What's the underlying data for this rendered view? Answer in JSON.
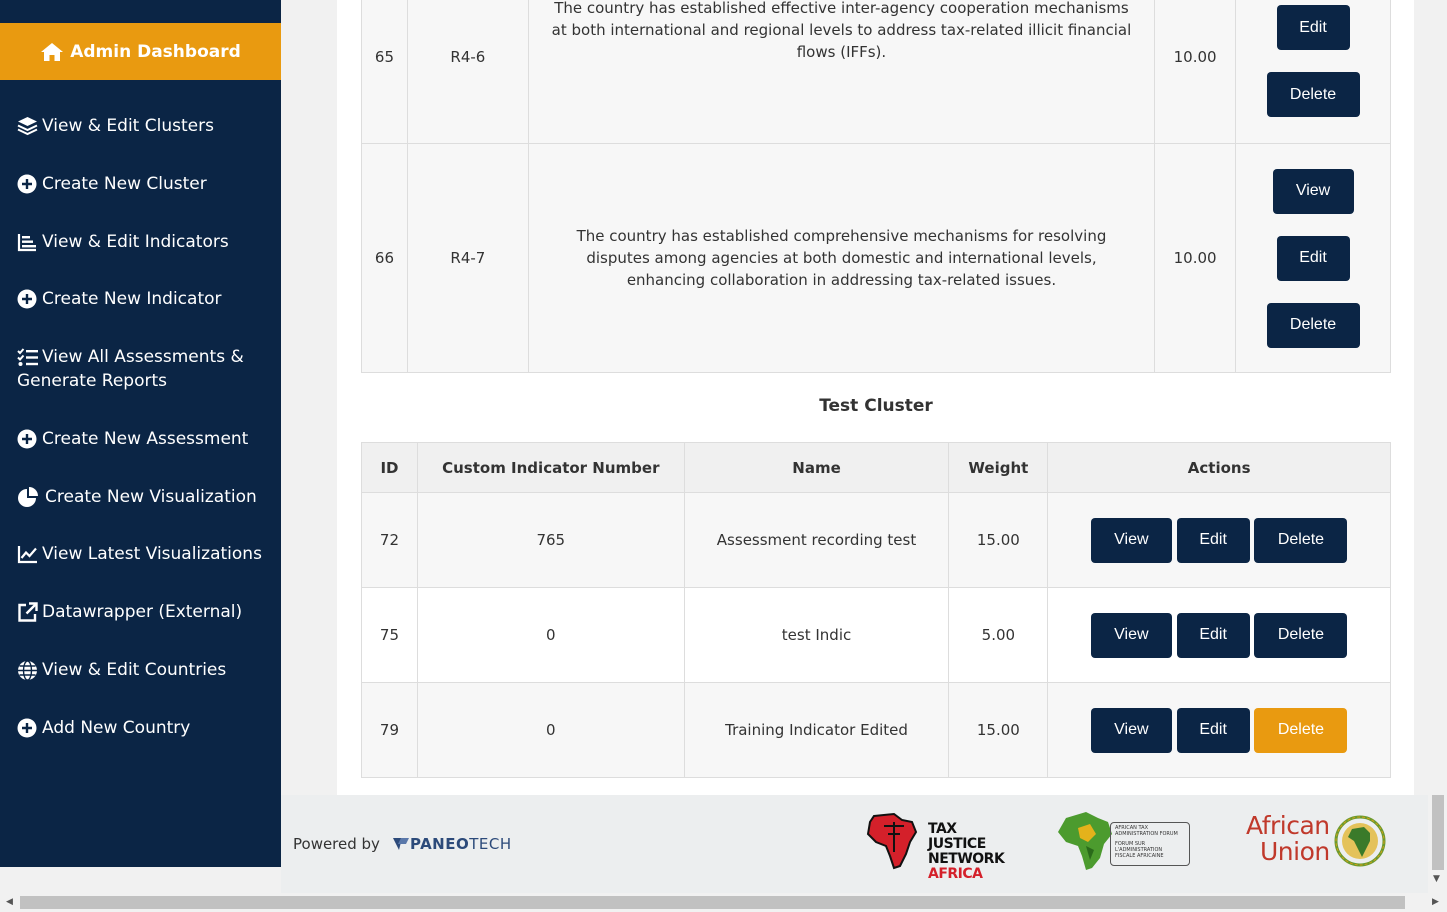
{
  "sidebar": {
    "header": "Admin Dashboard",
    "items": [
      {
        "label": "View & Edit Clusters",
        "icon": "layers-icon"
      },
      {
        "label": "Create New Cluster",
        "icon": "plus-circle-icon"
      },
      {
        "label": "View & Edit Indicators",
        "icon": "list-chart-icon"
      },
      {
        "label": "Create New Indicator",
        "icon": "plus-circle-icon"
      },
      {
        "label": "View All Assessments & Generate Reports",
        "icon": "checklist-icon"
      },
      {
        "label": "Create New Assessment",
        "icon": "plus-circle-icon"
      },
      {
        "label": "Create New Visualization",
        "icon": "pie-chart-icon"
      },
      {
        "label": "View Latest Visualizations",
        "icon": "line-chart-icon"
      },
      {
        "label": "Datawrapper (External)",
        "icon": "external-link-icon"
      },
      {
        "label": "View & Edit Countries",
        "icon": "globe-icon"
      },
      {
        "label": "Add New Country",
        "icon": "plus-circle-icon"
      }
    ]
  },
  "top_table": {
    "rows": [
      {
        "id": "65",
        "custom": "R4-6",
        "name": "The country has established effective inter-agency cooperation mechanisms at both international and regional levels to address tax-related illicit financial flows (IFFs).",
        "weight": "10.00"
      },
      {
        "id": "66",
        "custom": "R4-7",
        "name": "The country has established comprehensive mechanisms for resolving disputes among agencies at both domestic and international levels, enhancing collaboration in addressing tax-related issues.",
        "weight": "10.00"
      }
    ]
  },
  "cluster": {
    "title": "Test Cluster",
    "headers": {
      "id": "ID",
      "custom": "Custom Indicator Number",
      "name": "Name",
      "weight": "Weight",
      "actions": "Actions"
    },
    "rows": [
      {
        "id": "72",
        "custom": "765",
        "name": "Assessment recording test",
        "weight": "15.00"
      },
      {
        "id": "75",
        "custom": "0",
        "name": "test Indic",
        "weight": "5.00"
      },
      {
        "id": "79",
        "custom": "0",
        "name": "Training Indicator Edited",
        "weight": "15.00"
      }
    ]
  },
  "buttons": {
    "view": "View",
    "edit": "Edit",
    "delete": "Delete"
  },
  "footer": {
    "powered_by": "Powered by",
    "paneo_a": "PANEO",
    "paneo_b": "TECH",
    "tjn_line1": "TAX JUSTICE",
    "tjn_line2": "NETWORK",
    "tjn_line3": "AFRICA",
    "ataf_line1": "AFRICAN TAX",
    "ataf_line2": "ADMINISTRATION FORUM",
    "ataf_line3": "FORUM SUR",
    "ataf_line4": "L'ADMINISTRATION",
    "ataf_line5": "FISCALE AFRICAINE",
    "au_line1": "African",
    "au_line2": "Union"
  },
  "colors": {
    "sidebar": "#0b2545",
    "accent": "#e99a10",
    "button": "#0b2545"
  }
}
